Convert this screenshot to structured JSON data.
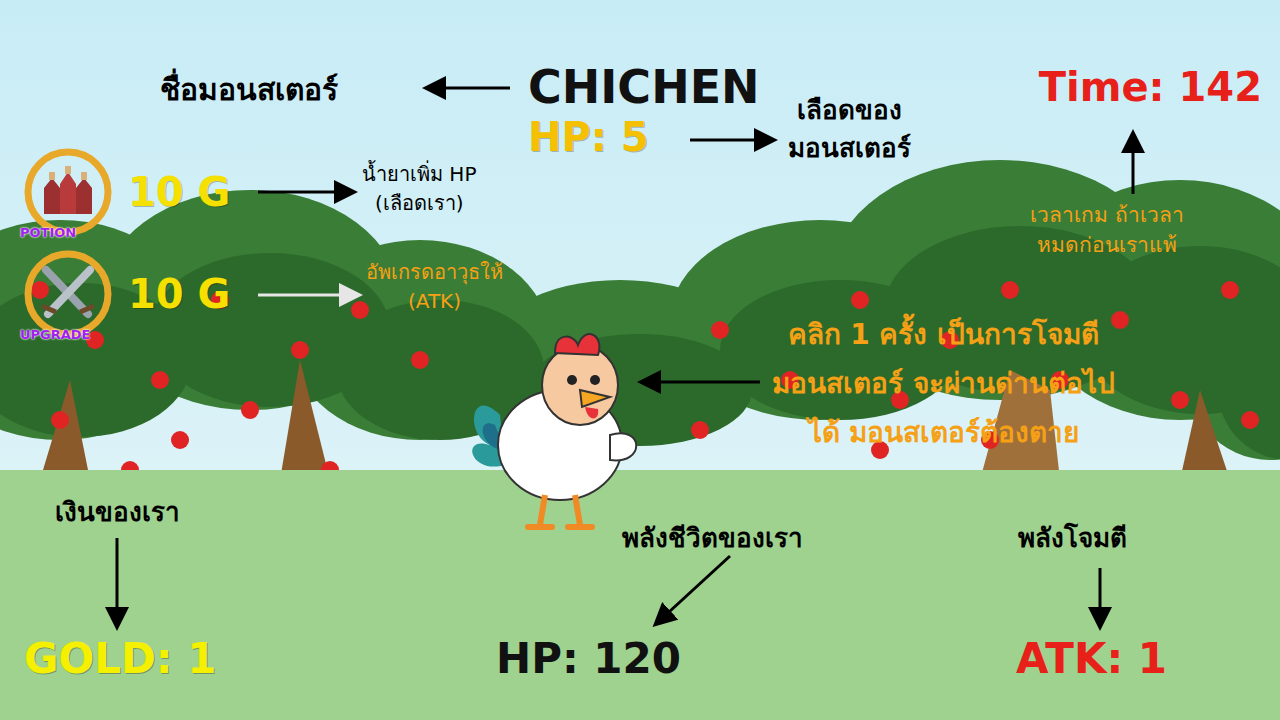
{
  "monster": {
    "name": "CHICHEN",
    "hp": "HP: 5"
  },
  "timer": "Time: 142",
  "shop": [
    {
      "label": "POTION",
      "price": "10 G"
    },
    {
      "label": "UPGRADE",
      "price": "10 G"
    }
  ],
  "player": {
    "gold": "GOLD: 1",
    "hp": "HP: 120",
    "atk": "ATK: 1"
  },
  "annotations": [
    {
      "lines": [
        "ชื่อมอนสเตอร์"
      ],
      "color": "#000000"
    },
    {
      "lines": [
        "เลือดของ",
        "มอนสเตอร์"
      ],
      "color": "#000000"
    },
    {
      "lines": [
        "น้ำยาเพิ่ม HP",
        "(เลือดเรา)"
      ],
      "color": "#000000"
    },
    {
      "lines": [
        "อัพเกรดอาวุธให้",
        "(ATK)"
      ],
      "color": "#f5a015"
    },
    {
      "lines": [
        "เวลาเกม ถ้าเวลา",
        "หมดก่อนเราแพ้"
      ],
      "color": "#f5a015"
    },
    {
      "lines": [
        "คลิก 1 ครั้ง เป็นการโจมตี",
        "มอนสเตอร์ จะผ่านด่านต่อไป",
        "ได้ มอนสเตอร์ต้องตาย"
      ],
      "color": "#f5a015"
    },
    {
      "lines": [
        "เงินของเรา"
      ],
      "color": "#000000"
    },
    {
      "lines": [
        "พลังชีวิตของเรา"
      ],
      "color": "#000000"
    },
    {
      "lines": [
        "พลังโจมตี"
      ],
      "color": "#000000"
    }
  ]
}
